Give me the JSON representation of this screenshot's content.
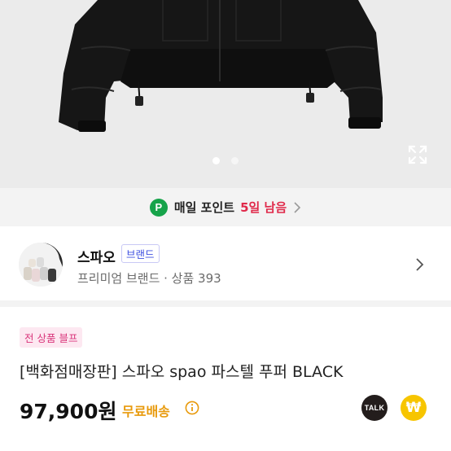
{
  "carousel": {
    "page_count": 2,
    "current_page": 1,
    "expand_icon": "expand-icon"
  },
  "points_banner": {
    "badge_letter": "P",
    "label": "매일 포인트",
    "remaining": "5일 남음",
    "chevron_icon": "chevron-right-icon"
  },
  "store": {
    "name": "스파오",
    "brand_tag": "브랜드",
    "subtitle": "프리미엄 브랜드 · 상품 393",
    "chevron_icon": "chevron-right-icon"
  },
  "product": {
    "promo_tag": "전 상품 블프",
    "title": "[백화점매장판] 스파오 spao 파스텔 푸퍼  BLACK",
    "price": "97,900원",
    "shipping": "무료배송",
    "info_icon": "info-icon"
  },
  "actions": {
    "talk_label": "TALK",
    "pay_symbol": "₩"
  },
  "colors": {
    "points_green": "#16a34a",
    "remaining_red": "#e0294a",
    "brand_blue": "#3f51e0",
    "promo_pink": "#d9347a",
    "shipping_orange": "#e89a0c",
    "talk_black": "#231d1c",
    "pay_yellow": "#f7c500"
  }
}
